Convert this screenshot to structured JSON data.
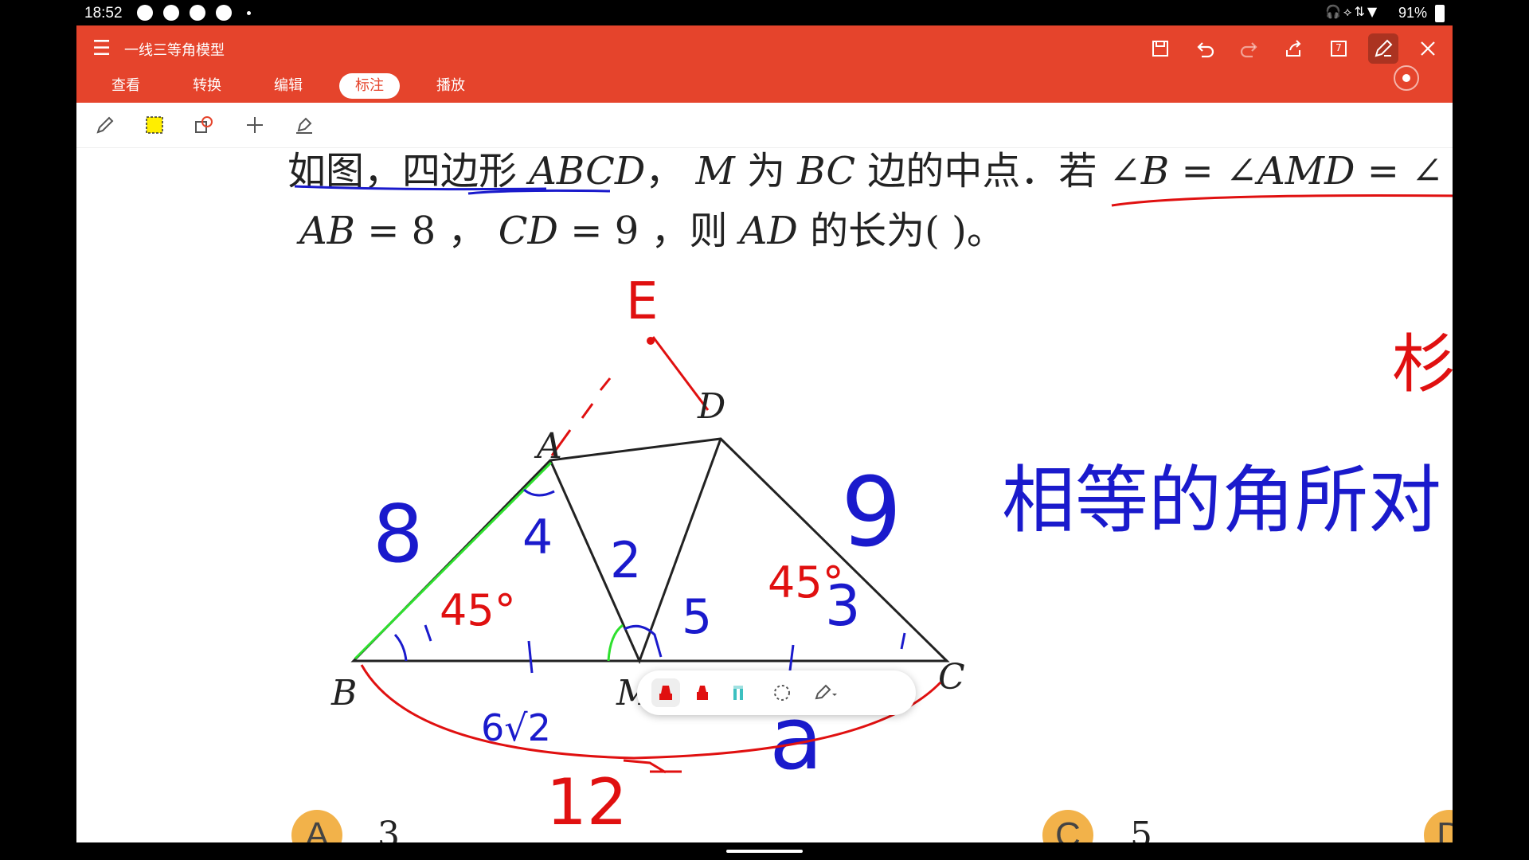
{
  "status": {
    "time": "18:52",
    "battery": "91%"
  },
  "app": {
    "title": "一线三等角模型",
    "tabs": [
      "查看",
      "转换",
      "编辑",
      "标注",
      "播放"
    ],
    "active_tab": "标注",
    "page_number": "7"
  },
  "problem": {
    "line1_a": "如图，四边形 ",
    "line1_b": "ABCD",
    "line1_c": "，  ",
    "line1_d": "M",
    "line1_e": " 为 ",
    "line1_f": "BC",
    "line1_g": " 边的中点．若 ∠",
    "line1_h": "B",
    "line1_i": " = ∠",
    "line1_j": "AMD",
    "line1_k": " = ∠",
    "line2_a": "AB",
    "line2_b": " = 8 ，  ",
    "line2_c": "CD",
    "line2_d": " = 9 ，则 ",
    "line2_e": "AD",
    "line2_f": " 的长为(      )。"
  },
  "figure": {
    "labels": {
      "A": "A",
      "B": "B",
      "C": "C",
      "D": "D",
      "M": "M"
    },
    "handwriting_blue": [
      "8",
      "4",
      "2",
      "5",
      "3",
      "9",
      "6√2",
      "a",
      "相等的角所对"
    ],
    "handwriting_red": [
      "E",
      "45°",
      "45°",
      "12",
      "杉"
    ]
  },
  "choices": [
    {
      "letter": "A",
      "value": "3"
    },
    {
      "letter": "C",
      "value": "5"
    },
    {
      "letter": "D",
      "value": ""
    }
  ],
  "colors": {
    "brand": "#e5442c",
    "ink_blue": "#1a1acc",
    "ink_red": "#e01010",
    "ink_green": "#2ee02e"
  }
}
